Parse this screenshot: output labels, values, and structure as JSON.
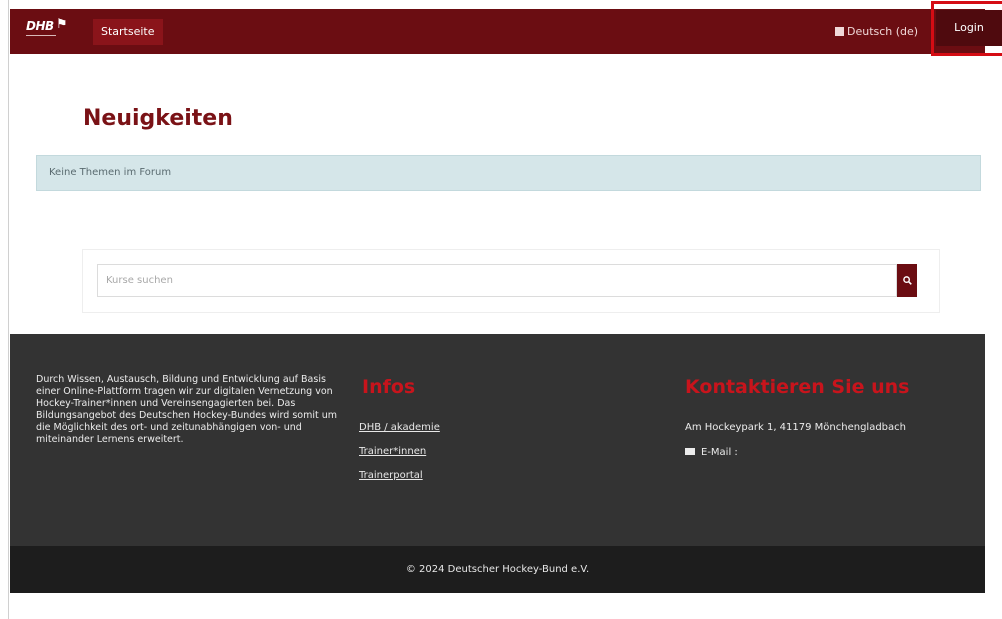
{
  "navbar": {
    "logo_text": "DHB",
    "home_label": "Startseite",
    "language_label": "Deutsch (de)",
    "login_label": "Login"
  },
  "main": {
    "title": "Neuigkeiten",
    "alert_text": "Keine Themen im Forum",
    "search": {
      "placeholder": "Kurse suchen"
    }
  },
  "footer": {
    "about_text": "Durch Wissen, Austausch, Bildung und Entwicklung auf Basis einer Online-Plattform tragen wir zur digitalen Vernetzung von Hockey-Trainer*innen und Vereinsengagierten bei. Das Bildungsangebot des Deutschen Hockey-Bundes wird somit um die Möglichkeit des ort- und zeitunabhängigen von- und miteinander Lernens erweitert.",
    "infos_title": "Infos",
    "links": [
      {
        "label": "DHB / akademie"
      },
      {
        "label": "Trainer*innen"
      },
      {
        "label": "Trainerportal"
      }
    ],
    "contact_title": "Kontaktieren Sie uns",
    "address": "Am Hockeypark 1, 41179 Mönchengladbach",
    "email_label": "E-Mail :",
    "email_address": "",
    "copyright": "© 2024 Deutscher Hockey-Bund e.V."
  },
  "colors": {
    "brand": "#6b0d12",
    "accent_red": "#c8141c",
    "footer_bg": "#333333",
    "copyright_bg": "#1d1d1d",
    "alert_bg": "#d5e6e9"
  },
  "icons": {
    "language": "language-icon",
    "search": "search-icon",
    "email": "envelope-icon"
  }
}
